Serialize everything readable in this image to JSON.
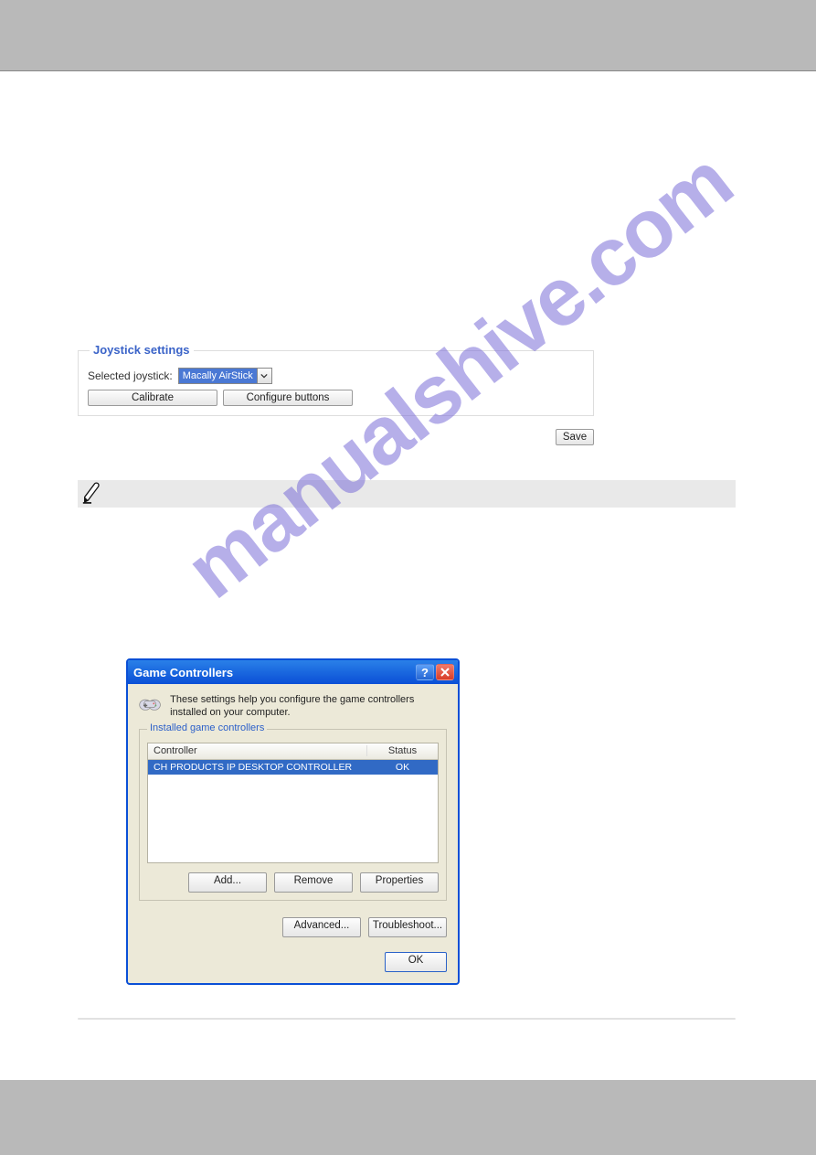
{
  "watermark": "manualshive.com",
  "joystick": {
    "legend": "Joystick settings",
    "label": "Selected joystick:",
    "selected": "Macally AirStick",
    "calibrate": "Calibrate",
    "configure": "Configure buttons",
    "save": "Save"
  },
  "gc": {
    "title": "Game Controllers",
    "help_symbol": "?",
    "intro": "These settings help you configure the game controllers installed on your computer.",
    "legend": "Installed game controllers",
    "col_controller": "Controller",
    "col_status": "Status",
    "row_controller": "CH PRODUCTS IP DESKTOP CONTROLLER",
    "row_status": "OK",
    "add": "Add...",
    "remove": "Remove",
    "properties": "Properties",
    "advanced": "Advanced...",
    "troubleshoot": "Troubleshoot...",
    "ok": "OK"
  }
}
